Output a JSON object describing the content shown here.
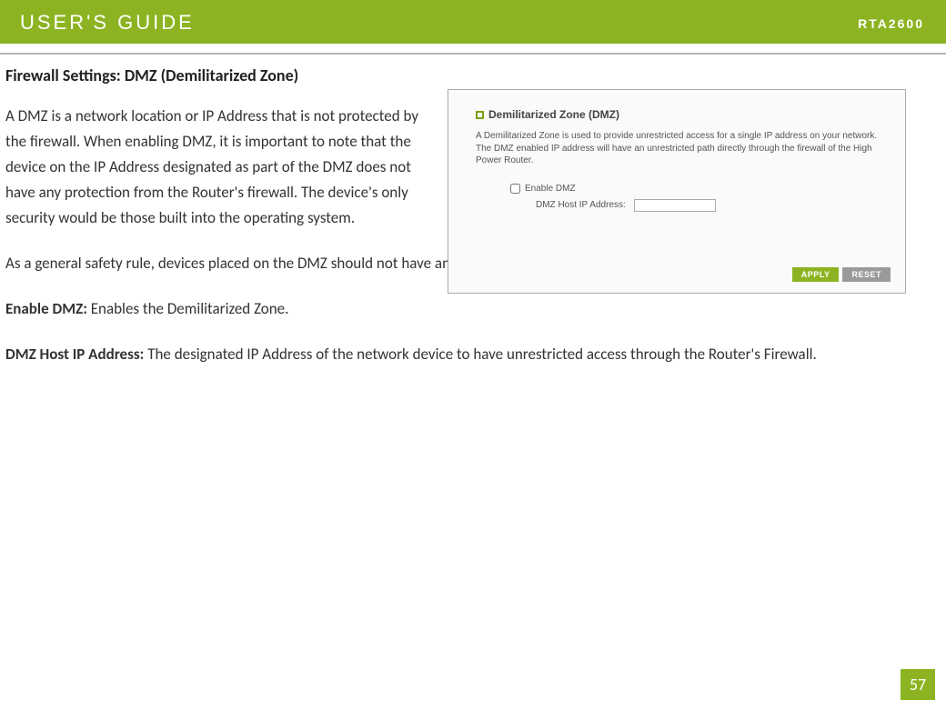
{
  "header": {
    "title": "USER'S GUIDE",
    "model": "RTA2600"
  },
  "section_title": "Firewall Settings: DMZ (Demilitarized Zone)",
  "paragraphs": {
    "p1": "A DMZ is a network location or IP Address that is not protected by the firewall.  When enabling DMZ, it is important to note that the device on the IP Address designated as part of the DMZ does not have any protection from the Router's firewall.  The device's only security would be those built into the operating system.",
    "p2": "As a general safety rule, devices placed on the DMZ should not have any other network connections to any other devices.",
    "p3_label": "Enable DMZ:",
    "p3_text": " Enables the Demilitarized Zone.",
    "p4_label": "DMZ Host IP Address:",
    "p4_text": " The designated IP Address of the network device to have unrestricted access through the Router's Firewall."
  },
  "screenshot": {
    "crumb": "Demilitarized Zone (DMZ)",
    "desc": "A Demilitarized Zone is used to provide unrestricted access for a single IP address on your network. The DMZ enabled IP address will have an unrestricted path directly through the firewall of the High Power Router.",
    "enable_label": "Enable DMZ",
    "ip_label": "DMZ Host IP Address:",
    "apply": "APPLY",
    "reset": "RESET"
  },
  "page_number": "57"
}
